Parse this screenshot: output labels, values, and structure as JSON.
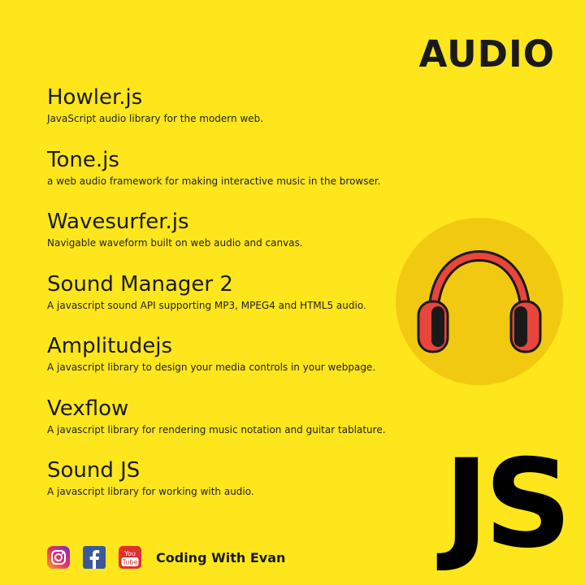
{
  "heading": "AUDIO",
  "libraries": [
    {
      "name": "Howler.js",
      "desc": "JavaScript audio library for the modern web."
    },
    {
      "name": "Tone.js",
      "desc": "a web audio framework for making interactive music in the browser."
    },
    {
      "name": "Wavesurfer.js",
      "desc": "Navigable waveform built on web audio and canvas."
    },
    {
      "name": "Sound Manager 2",
      "desc": "A javascript sound API supporting MP3, MPEG4 and HTML5 audio."
    },
    {
      "name": "Amplitudejs",
      "desc": "A javascript library to design your media controls in your webpage."
    },
    {
      "name": "Vexflow",
      "desc": "A javascript library for rendering music notation and guitar tablature."
    },
    {
      "name": "Sound JS",
      "desc": "A javascript library for working with audio."
    }
  ],
  "logo_text": "JS",
  "footer": {
    "icons": [
      "instagram-icon",
      "facebook-icon",
      "youtube-icon"
    ],
    "youtube_line1": "You",
    "youtube_line2": "Tube",
    "brand": "Coding With Evan"
  },
  "colors": {
    "background": "#FDE61C",
    "circle": "#F2C911",
    "headphone_red": "#E8453C",
    "text": "#1A1A1A"
  }
}
